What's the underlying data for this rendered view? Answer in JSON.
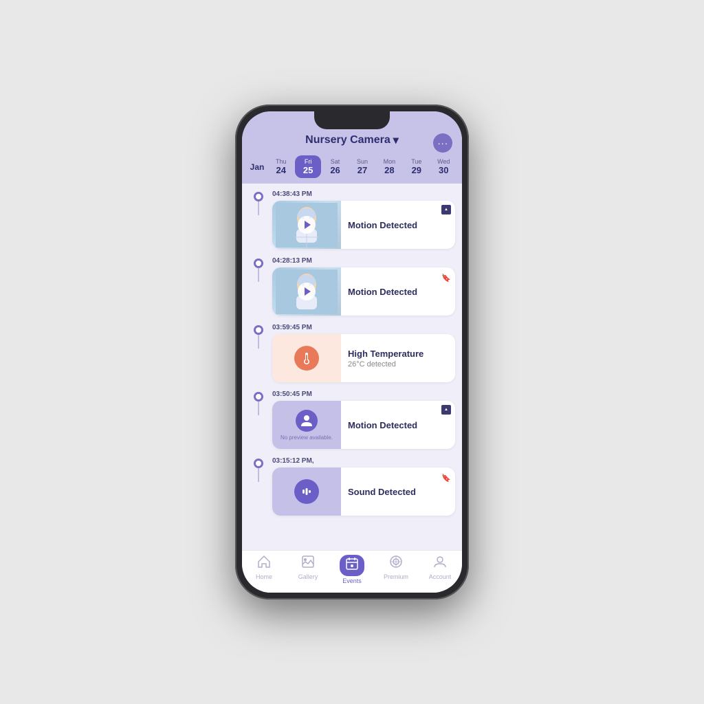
{
  "header": {
    "title": "Nursery Camera",
    "dropdown_icon": "▾",
    "menu_icon": "···"
  },
  "calendar": {
    "month": "Jan",
    "days": [
      {
        "name": "Thu",
        "num": "24",
        "active": false
      },
      {
        "name": "Fri",
        "num": "25",
        "active": true
      },
      {
        "name": "Sat",
        "num": "26",
        "active": false
      },
      {
        "name": "Sun",
        "num": "27",
        "active": false
      },
      {
        "name": "Mon",
        "num": "28",
        "active": false
      },
      {
        "name": "Tue",
        "num": "29",
        "active": false
      },
      {
        "name": "Wed",
        "num": "30",
        "active": false
      }
    ]
  },
  "events": [
    {
      "time": "04:38:43 PM",
      "type": "motion",
      "label": "Motion Detected",
      "has_video": true,
      "badge": "upload"
    },
    {
      "time": "04:28:13 PM",
      "type": "motion",
      "label": "Motion Detected",
      "has_video": true,
      "badge": "bookmark"
    },
    {
      "time": "03:59:45 PM",
      "type": "temperature",
      "label": "High Temperature",
      "sublabel": "26°C detected",
      "has_video": false,
      "badge": ""
    },
    {
      "time": "03:50:45  PM",
      "type": "motion_no_preview",
      "label": "Motion Detected",
      "no_preview_text": "No preview available.",
      "has_video": false,
      "badge": "upload"
    },
    {
      "time": "03:15:12 PM,",
      "type": "sound",
      "label": "Sound Detected",
      "has_video": false,
      "badge": "bookmark"
    }
  ],
  "nav": {
    "items": [
      {
        "label": "Home",
        "icon": "⌂",
        "active": false
      },
      {
        "label": "Gallery",
        "icon": "🖼",
        "active": false
      },
      {
        "label": "Events",
        "icon": "📅",
        "active": true
      },
      {
        "label": "Premium",
        "icon": "◎",
        "active": false
      },
      {
        "label": "Account",
        "icon": "👤",
        "active": false
      }
    ]
  }
}
